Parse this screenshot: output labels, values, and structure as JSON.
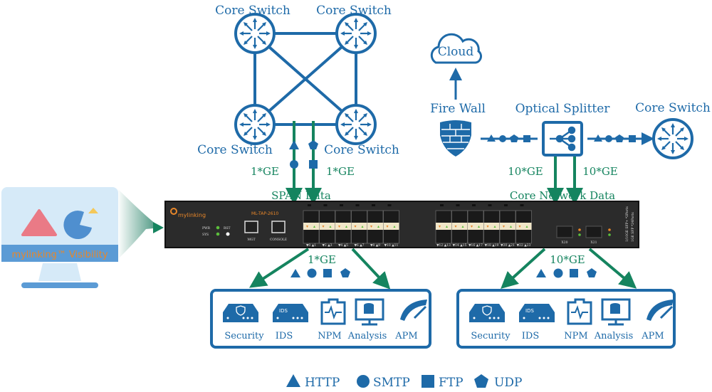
{
  "top_left": {
    "switch_labels": [
      "Core Switch",
      "Core Switch",
      "Core Switch",
      "Core Switch"
    ],
    "link_left": "1*GE",
    "link_right": "1*GE",
    "caption": "SPAN Data"
  },
  "top_right": {
    "cloud": "Cloud",
    "firewall": "Fire Wall",
    "splitter": "Optical Splitter",
    "core_switch": "Core Switch",
    "link_left": "10*GE",
    "link_right": "10*GE",
    "caption": "Core Network Data"
  },
  "device": {
    "brand": "mylinking",
    "model": "ML-TAP-2610",
    "leds": [
      "PWR",
      "SYS",
      "RST"
    ],
    "ports": [
      "MGT",
      "CONSOLE"
    ],
    "port_groups_left": [
      "▼0 ▲1",
      "▼2 ▲3",
      "▼4 ▲5",
      "▼6 ▲7",
      "▼8 ▲9",
      "▼10 ▲11"
    ],
    "port_groups_right": [
      "▼12 ▲13",
      "▼14 ▲15",
      "▼16 ▲17",
      "▼18 ▲19",
      "▼20 ▲21",
      "▼22 ▲23"
    ],
    "uplinks": [
      "X20",
      "X21"
    ],
    "side_text": [
      "1/10GE SFP+ *2Ports",
      "1GE SFP *24Ports"
    ]
  },
  "monitor": {
    "label": "mylinking™ Visibility"
  },
  "out_left": {
    "link": "1*GE",
    "tools": [
      "Security",
      "IDS",
      "NPM",
      "Analysis",
      "APM"
    ],
    "ids_badge": "IDS"
  },
  "out_right": {
    "link": "10*GE",
    "tools": [
      "Security",
      "IDS",
      "NPM",
      "Analysis",
      "APM"
    ],
    "ids_badge": "IDS"
  },
  "legend": [
    {
      "shape": "triangle",
      "label": "HTTP"
    },
    {
      "shape": "circle",
      "label": "SMTP"
    },
    {
      "shape": "square",
      "label": "FTP"
    },
    {
      "shape": "pentagon",
      "label": "UDP"
    }
  ],
  "colors": {
    "blue": "#1e6aa8",
    "green": "#15845f",
    "device": "#2b2b2b",
    "accent": "#e8872a"
  }
}
